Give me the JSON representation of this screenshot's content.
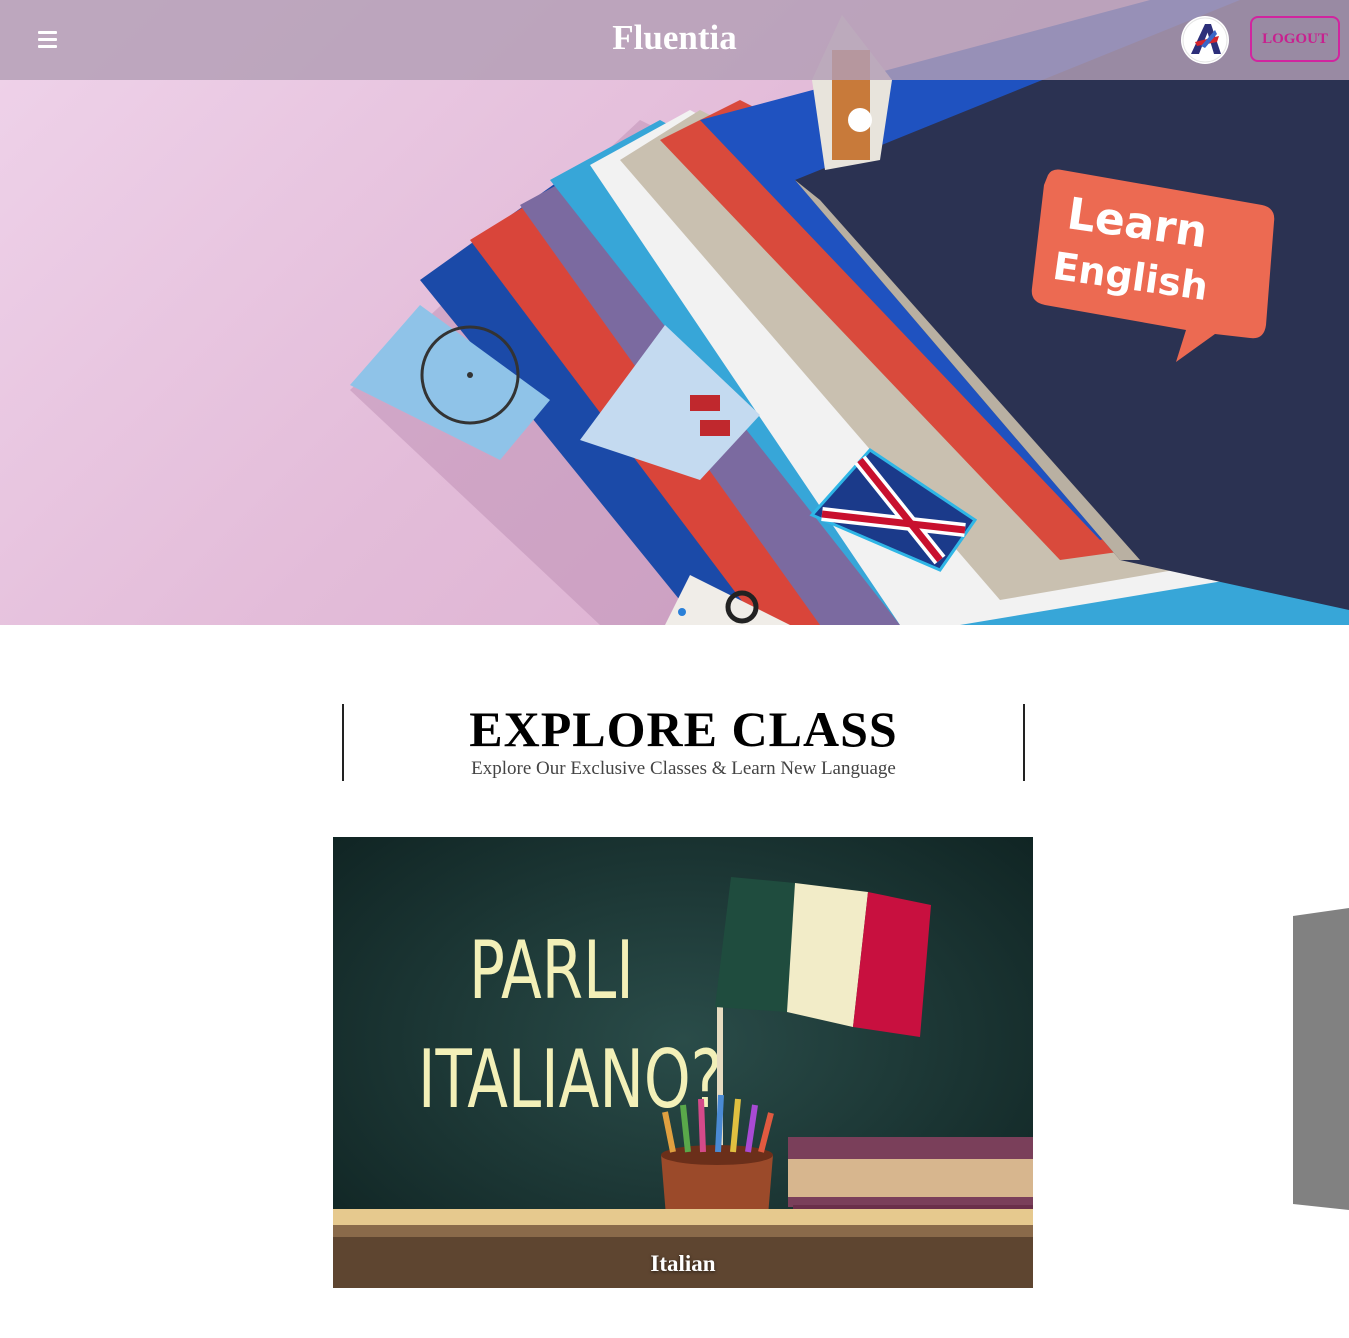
{
  "header": {
    "brand": "Fluentia",
    "menu_icon": "hamburger-menu-icon",
    "avatar_icon": "user-avatar-icon",
    "logout_label": "LOGOUT"
  },
  "hero": {
    "badge_line1": "Learn",
    "badge_line2": "English",
    "slides_total": 2,
    "active_slide": 1
  },
  "explore": {
    "title": "EXPLORE CLASS",
    "subtitle": "Explore Our Exclusive Classes & Learn New Language"
  },
  "classes": [
    {
      "name": "Italian",
      "chalk_line1": "PARLI",
      "chalk_line2": "ITALIANO?"
    }
  ],
  "colors": {
    "accent": "#d1259f",
    "hero_bg": "#e3bcd9",
    "slide_dot_active": "#2a80d8",
    "chalkboard": "#1f3c3a"
  }
}
